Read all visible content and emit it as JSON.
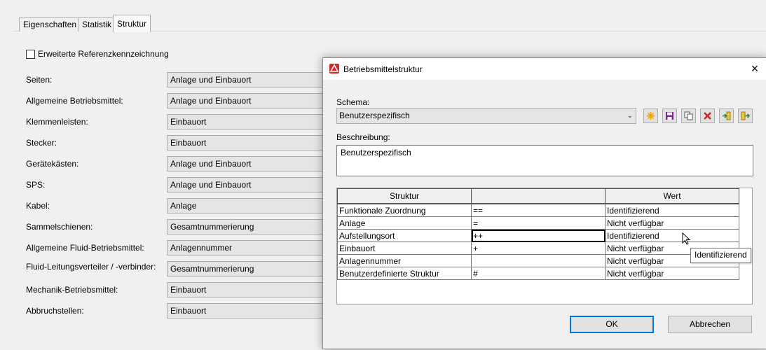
{
  "tabs": [
    {
      "label": "Eigenschaften"
    },
    {
      "label": "Statistik"
    },
    {
      "label": "Struktur",
      "active": true
    }
  ],
  "checkbox": {
    "label": "Erweiterte Referenzkennzeichnung",
    "checked": false
  },
  "rows": [
    {
      "label": "Seiten:",
      "value": "Anlage und Einbauort"
    },
    {
      "label": "Allgemeine Betriebsmittel:",
      "value": "Anlage und Einbauort"
    },
    {
      "label": "Klemmenleisten:",
      "value": "Einbauort"
    },
    {
      "label": "Stecker:",
      "value": "Einbauort"
    },
    {
      "label": "Gerätekästen:",
      "value": "Anlage und Einbauort"
    },
    {
      "label": "SPS:",
      "value": "Anlage und Einbauort"
    },
    {
      "label": "Kabel:",
      "value": "Anlage"
    },
    {
      "label": "Sammelschienen:",
      "value": "Gesamtnummerierung"
    },
    {
      "label": "Allgemeine Fluid-Betriebsmittel:",
      "value": "Anlagennummer"
    },
    {
      "label": "Fluid-Leitungsverteiler / -verbinder:",
      "value": "Gesamtnummerierung"
    },
    {
      "label": "Mechanik-Betriebsmittel:",
      "value": "Einbauort"
    },
    {
      "label": "Abbruchstellen:",
      "value": "Einbauort"
    }
  ],
  "dialog": {
    "title": "Betriebsmittelstruktur",
    "close_symbol": "×",
    "schema_label": "Schema:",
    "schema_value": "Benutzerspezifisch",
    "description_label": "Beschreibung:",
    "description_value": "Benutzerspezifisch",
    "toolbar_icons": [
      "new-icon",
      "save-icon",
      "copy-icon",
      "delete-icon",
      "import-icon",
      "export-icon"
    ],
    "grid": {
      "headers": [
        "Struktur",
        "",
        "Wert"
      ],
      "rows": [
        {
          "struktur": "Funktionale Zuordnung",
          "symbol": "==",
          "wert": "Identifizierend"
        },
        {
          "struktur": "Anlage",
          "symbol": "=",
          "wert": "Nicht verfügbar"
        },
        {
          "struktur": "Aufstellungsort",
          "symbol": "++",
          "wert": "Identifizierend"
        },
        {
          "struktur": "Einbauort",
          "symbol": "+",
          "wert": "Nicht verfügbar"
        },
        {
          "struktur": "Anlagennummer",
          "symbol": "",
          "wert": "Nicht verfügbar"
        },
        {
          "struktur": "Benutzerdefinierte Struktur",
          "symbol": "#",
          "wert": "Nicht verfügbar"
        }
      ]
    },
    "ok_label": "OK",
    "cancel_label": "Abbrechen"
  },
  "tooltip": "Identifizierend",
  "colors": {
    "title_icon": "#d9262b",
    "default_button_border": "#0078d7"
  }
}
